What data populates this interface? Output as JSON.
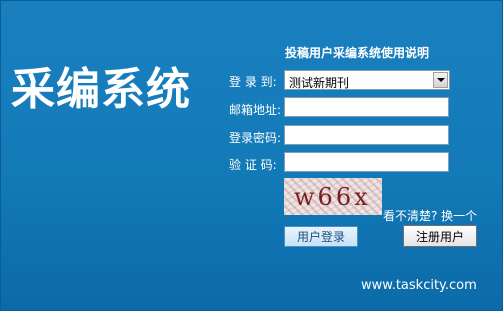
{
  "brand": {
    "title": "采编系统"
  },
  "help_link": "投稿用户采编系统使用说明",
  "form": {
    "target_label": "登 录 到:",
    "target_value": "测试新期刊",
    "email_label": "邮箱地址:",
    "email_value": "",
    "password_label": "登录密码:",
    "password_value": "",
    "captcha_label": "验 证 码:",
    "captcha_value": "",
    "captcha_image_text": "w66x",
    "refresh_link": "看不清楚? 换一个",
    "login_button": "用户登录",
    "register_button": "注册用户"
  },
  "footer": {
    "site_url": "www.taskcity.com"
  },
  "colors": {
    "panel_background": "#1a7fbf",
    "panel_border": "#0b5d93",
    "text": "#ffffff"
  }
}
